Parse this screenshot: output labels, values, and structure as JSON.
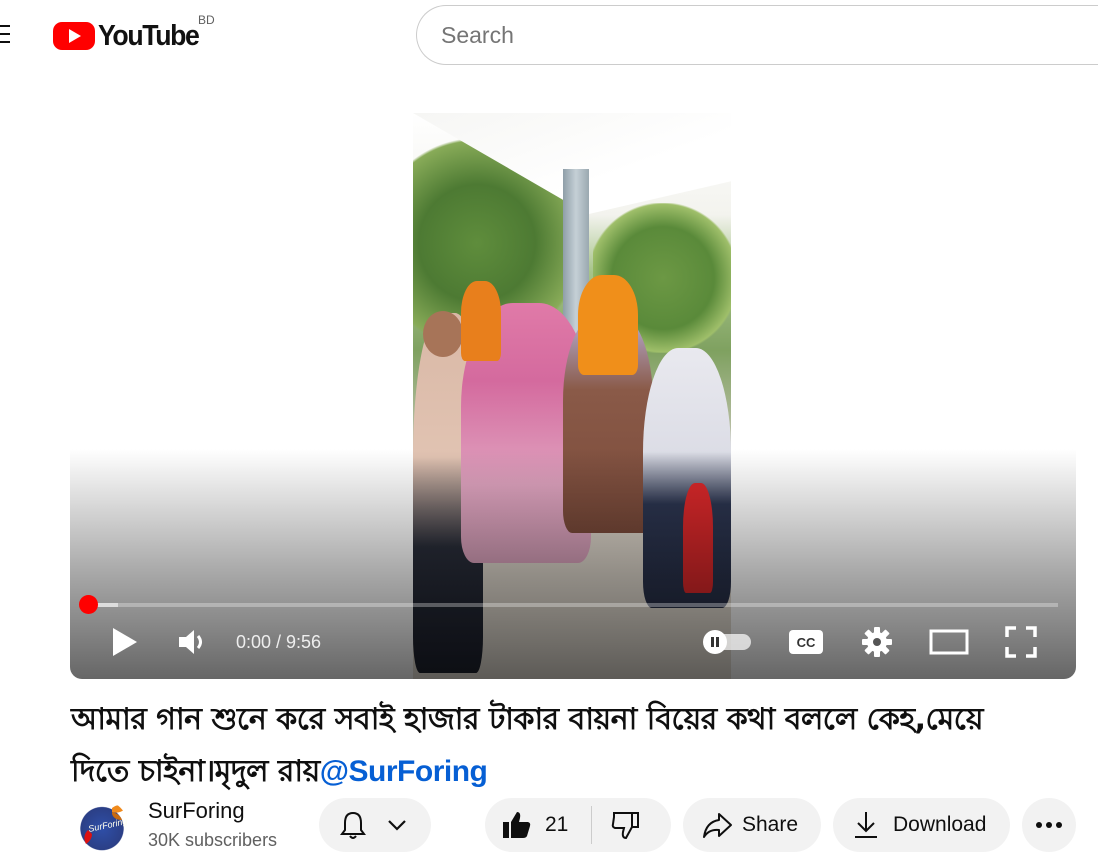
{
  "masthead": {
    "logo_text": "YouTube",
    "country_code": "BD",
    "search_placeholder": "Search",
    "icons": [
      "menu-icon",
      "youtube-logo-icon"
    ],
    "brand_color": "#FF0000"
  },
  "player": {
    "current_time": "0:00",
    "duration": "9:56",
    "time_display": "0:00 / 9:56",
    "progress": 0.0,
    "controls": [
      "play-icon",
      "volume-icon",
      "autoplay-toggle-icon",
      "captions-icon",
      "settings-icon",
      "theater-mode-icon",
      "fullscreen-icon"
    ],
    "captions_label": "CC"
  },
  "video": {
    "title_text": "আমার গান শুনে করে সবাই হাজার টাকার বায়না বিয়ের কথা বললে কেহ,মেয়ে দিতে চাইনা।মৃদুল রায়",
    "title_link": "@SurForing"
  },
  "owner": {
    "channel_name": "SurForing",
    "subscribers": "30K subscribers",
    "avatar_text": "SurForing"
  },
  "actions": {
    "like_count": "21",
    "share_label": "Share",
    "download_label": "Download",
    "icons": [
      "bell-icon",
      "chevron-down-icon",
      "like-icon",
      "dislike-icon",
      "share-icon",
      "download-icon",
      "more-icon"
    ]
  }
}
